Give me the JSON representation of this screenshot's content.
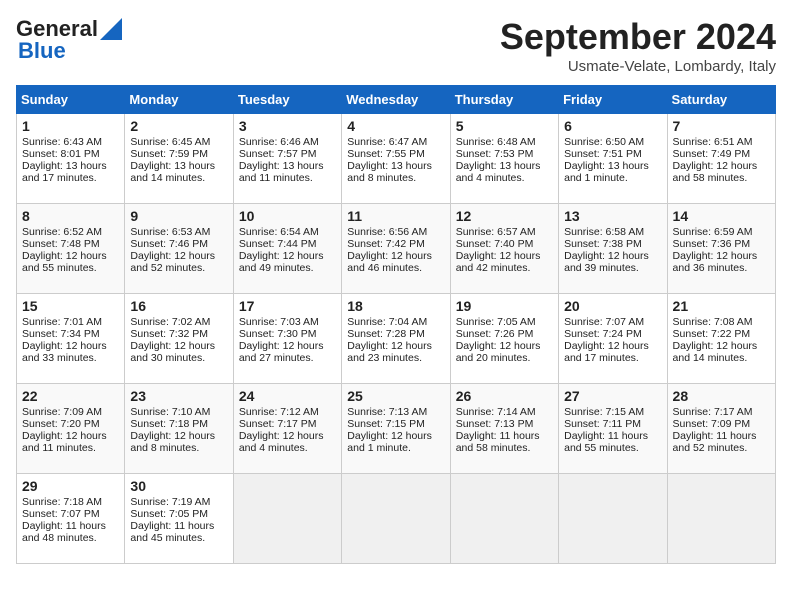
{
  "header": {
    "logo_general": "General",
    "logo_blue": "Blue",
    "month_title": "September 2024",
    "location": "Usmate-Velate, Lombardy, Italy"
  },
  "days_of_week": [
    "Sunday",
    "Monday",
    "Tuesday",
    "Wednesday",
    "Thursday",
    "Friday",
    "Saturday"
  ],
  "weeks": [
    [
      {
        "day": 1,
        "lines": [
          "Sunrise: 6:43 AM",
          "Sunset: 8:01 PM",
          "Daylight: 13 hours",
          "and 17 minutes."
        ]
      },
      {
        "day": 2,
        "lines": [
          "Sunrise: 6:45 AM",
          "Sunset: 7:59 PM",
          "Daylight: 13 hours",
          "and 14 minutes."
        ]
      },
      {
        "day": 3,
        "lines": [
          "Sunrise: 6:46 AM",
          "Sunset: 7:57 PM",
          "Daylight: 13 hours",
          "and 11 minutes."
        ]
      },
      {
        "day": 4,
        "lines": [
          "Sunrise: 6:47 AM",
          "Sunset: 7:55 PM",
          "Daylight: 13 hours",
          "and 8 minutes."
        ]
      },
      {
        "day": 5,
        "lines": [
          "Sunrise: 6:48 AM",
          "Sunset: 7:53 PM",
          "Daylight: 13 hours",
          "and 4 minutes."
        ]
      },
      {
        "day": 6,
        "lines": [
          "Sunrise: 6:50 AM",
          "Sunset: 7:51 PM",
          "Daylight: 13 hours",
          "and 1 minute."
        ]
      },
      {
        "day": 7,
        "lines": [
          "Sunrise: 6:51 AM",
          "Sunset: 7:49 PM",
          "Daylight: 12 hours",
          "and 58 minutes."
        ]
      }
    ],
    [
      {
        "day": 8,
        "lines": [
          "Sunrise: 6:52 AM",
          "Sunset: 7:48 PM",
          "Daylight: 12 hours",
          "and 55 minutes."
        ]
      },
      {
        "day": 9,
        "lines": [
          "Sunrise: 6:53 AM",
          "Sunset: 7:46 PM",
          "Daylight: 12 hours",
          "and 52 minutes."
        ]
      },
      {
        "day": 10,
        "lines": [
          "Sunrise: 6:54 AM",
          "Sunset: 7:44 PM",
          "Daylight: 12 hours",
          "and 49 minutes."
        ]
      },
      {
        "day": 11,
        "lines": [
          "Sunrise: 6:56 AM",
          "Sunset: 7:42 PM",
          "Daylight: 12 hours",
          "and 46 minutes."
        ]
      },
      {
        "day": 12,
        "lines": [
          "Sunrise: 6:57 AM",
          "Sunset: 7:40 PM",
          "Daylight: 12 hours",
          "and 42 minutes."
        ]
      },
      {
        "day": 13,
        "lines": [
          "Sunrise: 6:58 AM",
          "Sunset: 7:38 PM",
          "Daylight: 12 hours",
          "and 39 minutes."
        ]
      },
      {
        "day": 14,
        "lines": [
          "Sunrise: 6:59 AM",
          "Sunset: 7:36 PM",
          "Daylight: 12 hours",
          "and 36 minutes."
        ]
      }
    ],
    [
      {
        "day": 15,
        "lines": [
          "Sunrise: 7:01 AM",
          "Sunset: 7:34 PM",
          "Daylight: 12 hours",
          "and 33 minutes."
        ]
      },
      {
        "day": 16,
        "lines": [
          "Sunrise: 7:02 AM",
          "Sunset: 7:32 PM",
          "Daylight: 12 hours",
          "and 30 minutes."
        ]
      },
      {
        "day": 17,
        "lines": [
          "Sunrise: 7:03 AM",
          "Sunset: 7:30 PM",
          "Daylight: 12 hours",
          "and 27 minutes."
        ]
      },
      {
        "day": 18,
        "lines": [
          "Sunrise: 7:04 AM",
          "Sunset: 7:28 PM",
          "Daylight: 12 hours",
          "and 23 minutes."
        ]
      },
      {
        "day": 19,
        "lines": [
          "Sunrise: 7:05 AM",
          "Sunset: 7:26 PM",
          "Daylight: 12 hours",
          "and 20 minutes."
        ]
      },
      {
        "day": 20,
        "lines": [
          "Sunrise: 7:07 AM",
          "Sunset: 7:24 PM",
          "Daylight: 12 hours",
          "and 17 minutes."
        ]
      },
      {
        "day": 21,
        "lines": [
          "Sunrise: 7:08 AM",
          "Sunset: 7:22 PM",
          "Daylight: 12 hours",
          "and 14 minutes."
        ]
      }
    ],
    [
      {
        "day": 22,
        "lines": [
          "Sunrise: 7:09 AM",
          "Sunset: 7:20 PM",
          "Daylight: 12 hours",
          "and 11 minutes."
        ]
      },
      {
        "day": 23,
        "lines": [
          "Sunrise: 7:10 AM",
          "Sunset: 7:18 PM",
          "Daylight: 12 hours",
          "and 8 minutes."
        ]
      },
      {
        "day": 24,
        "lines": [
          "Sunrise: 7:12 AM",
          "Sunset: 7:17 PM",
          "Daylight: 12 hours",
          "and 4 minutes."
        ]
      },
      {
        "day": 25,
        "lines": [
          "Sunrise: 7:13 AM",
          "Sunset: 7:15 PM",
          "Daylight: 12 hours",
          "and 1 minute."
        ]
      },
      {
        "day": 26,
        "lines": [
          "Sunrise: 7:14 AM",
          "Sunset: 7:13 PM",
          "Daylight: 11 hours",
          "and 58 minutes."
        ]
      },
      {
        "day": 27,
        "lines": [
          "Sunrise: 7:15 AM",
          "Sunset: 7:11 PM",
          "Daylight: 11 hours",
          "and 55 minutes."
        ]
      },
      {
        "day": 28,
        "lines": [
          "Sunrise: 7:17 AM",
          "Sunset: 7:09 PM",
          "Daylight: 11 hours",
          "and 52 minutes."
        ]
      }
    ],
    [
      {
        "day": 29,
        "lines": [
          "Sunrise: 7:18 AM",
          "Sunset: 7:07 PM",
          "Daylight: 11 hours",
          "and 48 minutes."
        ]
      },
      {
        "day": 30,
        "lines": [
          "Sunrise: 7:19 AM",
          "Sunset: 7:05 PM",
          "Daylight: 11 hours",
          "and 45 minutes."
        ]
      },
      null,
      null,
      null,
      null,
      null
    ]
  ]
}
